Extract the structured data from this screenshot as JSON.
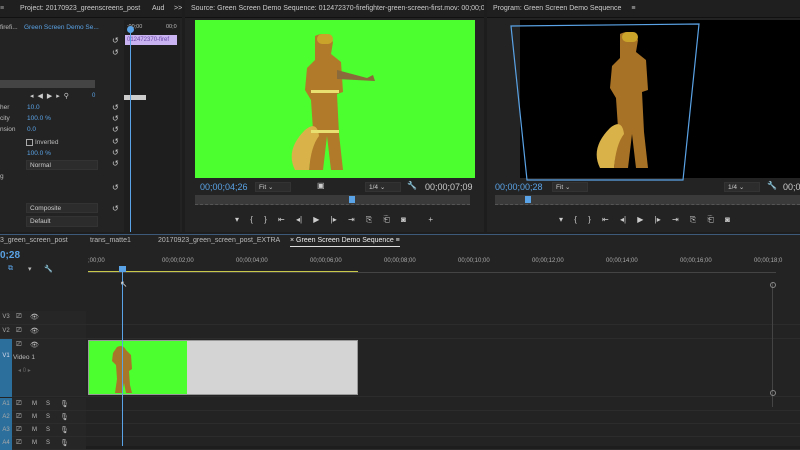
{
  "effect_controls": {
    "project_title": "Project: 20170923_greenscreens_post",
    "aud_tab": "Aud",
    "more": ">>",
    "clip_dropdown": "firefi...",
    "sequence_dropdown": "Green Screen Demo Se...",
    "mini_ruler_start": ";00;00",
    "mini_ruler_next": "00;0",
    "clip_label": "012472370-firef",
    "rows": [
      {
        "label": "her",
        "value": "10.0"
      },
      {
        "label": "city",
        "value": "100.0 %"
      },
      {
        "label": "nsion",
        "value": "0.0"
      },
      {
        "label": "",
        "value": "Inverted"
      },
      {
        "label": "",
        "value": "100.0 %"
      },
      {
        "label": "",
        "value": "Normal"
      },
      {
        "label": "g",
        "value": ""
      }
    ],
    "composite": "Composite",
    "default": "Default",
    "keyframe_value": "0"
  },
  "source": {
    "title": "Source: Green Screen Demo Sequence: 012472370-firefighter-green-screen-first.mov: 00;00;0",
    "timecode": "00;00;04;26",
    "fit": "Fit",
    "resolution": "1/4",
    "duration": "00;00;07;09",
    "playhead_fraction": 0.57
  },
  "program": {
    "title": "Program: Green Screen Demo Sequence",
    "timecode": "00;00;00;28",
    "fit": "Fit",
    "resolution": "1/4",
    "duration": "00;0",
    "playhead_fraction": 0.1
  },
  "timeline": {
    "tabs": [
      "3_green_screen_post",
      "trans_matte1",
      "20170923_green_screen_post_EXTRA",
      "Green Screen Demo Sequence"
    ],
    "active_tab": 3,
    "timecode": "0;28",
    "ruler": [
      ";00;00",
      "00;00;02;00",
      "00;00;04;00",
      "00;00;06;00",
      "00;00;08;00",
      "00;00;10;00",
      "00;00;12;00",
      "00;00;14;00",
      "00;00;16;00",
      "00;00;18;0"
    ],
    "tracks": {
      "v3": "V3",
      "v2": "V2",
      "v1": "V1",
      "v1_name": "Video 1",
      "a1": "A1",
      "a2": "A2",
      "a3": "A3",
      "a4": "A4",
      "m": "M",
      "s": "S",
      "kf": "0"
    }
  },
  "colors": {
    "accent": "#5aa3e6",
    "green": "#4cff2e",
    "clip_purple": "#c9b3f0"
  }
}
